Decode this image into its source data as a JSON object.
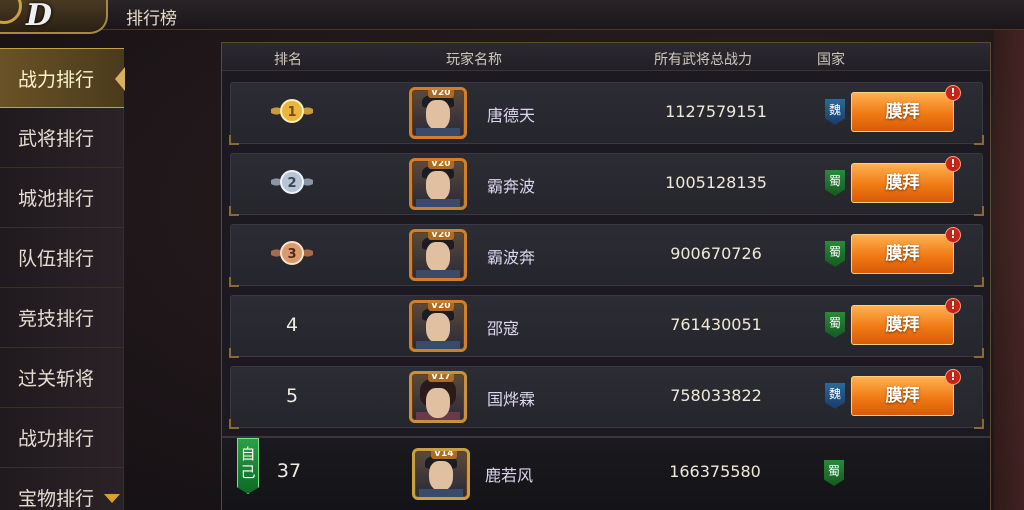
{
  "topbar": {
    "title": "排行榜"
  },
  "sidebar": {
    "items": [
      {
        "label": "战力排行",
        "active": true
      },
      {
        "label": "武将排行",
        "active": false
      },
      {
        "label": "城池排行",
        "active": false
      },
      {
        "label": "队伍排行",
        "active": false
      },
      {
        "label": "竞技排行",
        "active": false
      },
      {
        "label": "过关斩将",
        "active": false
      },
      {
        "label": "战功排行",
        "active": false
      },
      {
        "label": "宝物排行",
        "active": false
      }
    ]
  },
  "table": {
    "headers": {
      "rank": "排名",
      "player": "玩家名称",
      "power": "所有武将总战力",
      "country": "国家"
    },
    "rows": [
      {
        "rank": "1",
        "medal": "gold-medal",
        "vip": "V20",
        "name": "唐德天",
        "power": "1127579151",
        "country": "魏",
        "action": "膜拜"
      },
      {
        "rank": "2",
        "medal": "silver-medal",
        "vip": "V20",
        "name": "霸奔波",
        "power": "1005128135",
        "country": "蜀",
        "action": "膜拜"
      },
      {
        "rank": "3",
        "medal": "bronze-medal",
        "vip": "V20",
        "name": "霸波奔",
        "power": "900670726",
        "country": "蜀",
        "action": "膜拜"
      },
      {
        "rank": "4",
        "medal": "",
        "vip": "V20",
        "name": "邵寇",
        "power": "761430051",
        "country": "蜀",
        "action": "膜拜"
      },
      {
        "rank": "5",
        "medal": "",
        "vip": "V17",
        "name": "国烨霖",
        "power": "758033822",
        "country": "魏",
        "action": "膜拜"
      }
    ],
    "self": {
      "badge": "自己",
      "rank": "37",
      "vip": "V14",
      "name": "鹿若风",
      "power": "166375580",
      "country": "蜀"
    },
    "alert_mark": "!"
  },
  "colors": {
    "accent": "#f07a14",
    "gold": "#c9a046",
    "wei": "#2a6a9a",
    "shu": "#2a8a3a"
  }
}
